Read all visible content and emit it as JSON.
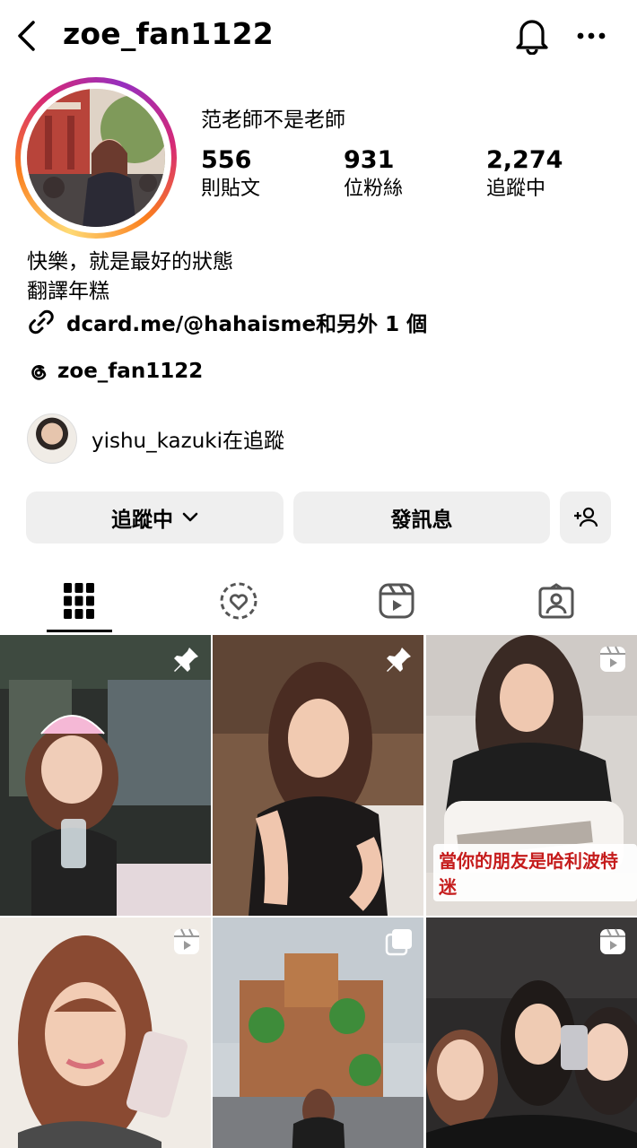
{
  "header": {
    "username": "zoe_fan1122"
  },
  "profile": {
    "display_name": "范老師不是老師",
    "stats": [
      {
        "value": "556",
        "label": "則貼文"
      },
      {
        "value": "931",
        "label": "位粉絲"
      },
      {
        "value": "2,274",
        "label": "追蹤中"
      }
    ],
    "bio_lines": [
      "快樂，就是最好的狀態",
      "翻譯年糕"
    ],
    "link_text": "dcard.me/@hahaisme和另外 1 個",
    "threads_handle": "zoe_fan1122",
    "followed_by": {
      "username": "yishu_kazuki",
      "suffix": "在追蹤"
    }
  },
  "actions": {
    "following_label": "追蹤中",
    "message_label": "發訊息"
  },
  "tabs": [
    {
      "name": "grid-icon",
      "active": true
    },
    {
      "name": "collab-icon",
      "active": false
    },
    {
      "name": "reels-icon",
      "active": false
    },
    {
      "name": "tagged-icon",
      "active": false
    }
  ],
  "posts": [
    {
      "badge": "pin-icon",
      "caption": ""
    },
    {
      "badge": "pin-icon",
      "caption": ""
    },
    {
      "badge": "reel-icon",
      "caption": "當你的朋友是哈利波特迷"
    },
    {
      "badge": "reel-icon",
      "caption": ""
    },
    {
      "badge": "carousel-icon",
      "caption": ""
    },
    {
      "badge": "reel-icon",
      "caption": ""
    }
  ],
  "colors": {
    "button_bg": "#efefef",
    "caption_red": "#c51c1c"
  }
}
